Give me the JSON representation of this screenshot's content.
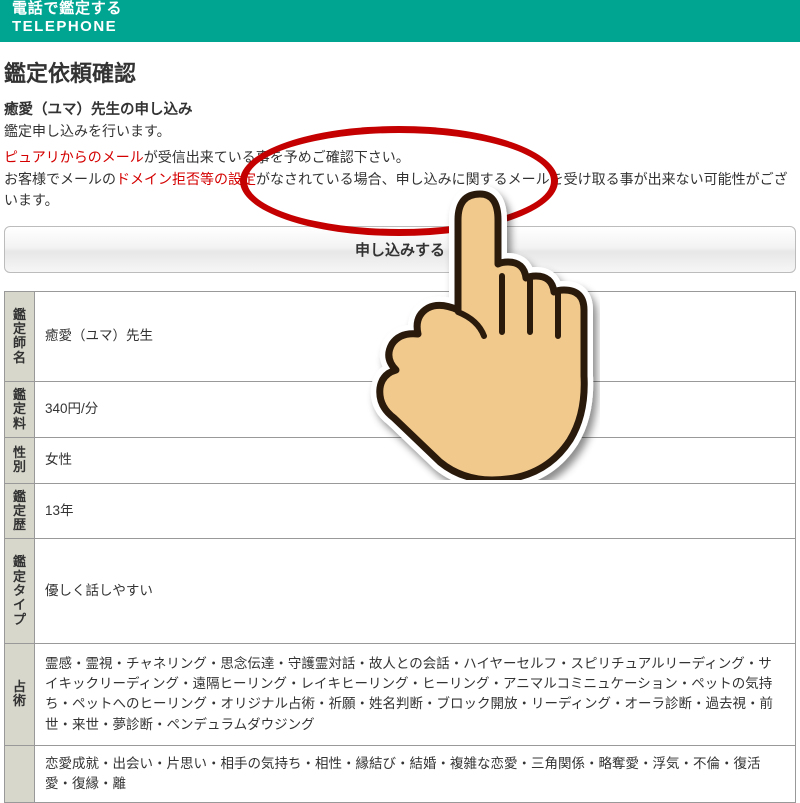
{
  "header": {
    "title_jp": "電話で鑑定する",
    "title_en": "TELEPHONE"
  },
  "page": {
    "title": "鑑定依頼確認",
    "sub_title": "癒愛（ユマ）先生の申し込み",
    "desc": "鑑定申し込みを行います。",
    "notice_red1": "ピュアリからのメール",
    "notice_tail1": "が受信出来ている事を予めご確認下さい。",
    "notice_head2": "お客様でメールの",
    "notice_red2": "ドメイン拒否等の設定",
    "notice_tail2": "がなされている場合、申し込みに関するメールを受け取る事が出来ない可能性がございます。",
    "apply_label": "申し込みする"
  },
  "details": {
    "rows": [
      {
        "label": "鑑定師名",
        "value": "癒愛（ユマ）先生"
      },
      {
        "label": "鑑定料",
        "value": "340円/分"
      },
      {
        "label": "性別",
        "value": "女性"
      },
      {
        "label": "鑑定歴",
        "value": "13年"
      },
      {
        "label": "鑑定タイプ",
        "value": "優しく話しやすい"
      },
      {
        "label": "占術",
        "value": "霊感・霊視・チャネリング・思念伝達・守護霊対話・故人との会話・ハイヤーセルフ・スピリチュアルリーディング・サイキックリーディング・遠隔ヒーリング・レイキヒーリング・ヒーリング・アニマルコミニュケーション・ペットの気持ち・ペットへのヒーリング・オリジナル占術・祈願・姓名判断・ブロック開放・リーディング・オーラ診断・過去視・前世・来世・夢診断・ペンデュラムダウジング"
      },
      {
        "label": "",
        "value": "恋愛成就・出会い・片思い・相手の気持ち・相性・縁結び・結婚・複雑な恋愛・三角関係・略奪愛・浮気・不倫・復活愛・復縁・離"
      }
    ]
  }
}
